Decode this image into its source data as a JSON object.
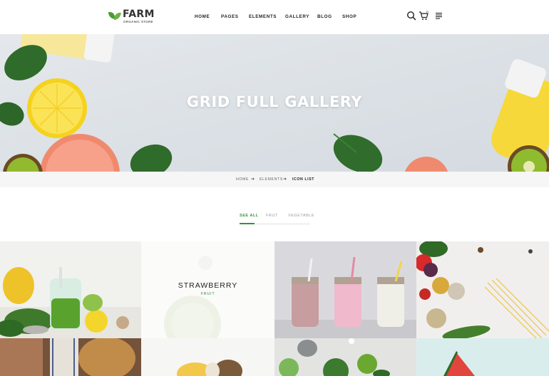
{
  "brand": {
    "name": "FARM",
    "tagline": "ORGANIC STORE",
    "accent": "#3a8f3a"
  },
  "nav": {
    "items": [
      "HOME",
      "PAGES",
      "ELEMENTS",
      "GALLERY",
      "BLOG",
      "SHOP"
    ]
  },
  "header_icons": {
    "search": "search-icon",
    "cart": "cart-icon",
    "cart_count": "0",
    "menu": "menu-icon"
  },
  "hero": {
    "title": "GRID FULL GALLERY"
  },
  "breadcrumb": {
    "items": [
      "HOME",
      "ELEMENTS",
      "ICON LIST"
    ]
  },
  "filters": {
    "items": [
      "SEE ALL",
      "FRUT",
      "VEGETABLE"
    ],
    "active": "SEE ALL"
  },
  "gallery": {
    "featured": {
      "title": "STRAWBERRY",
      "category": "FRUIT"
    },
    "tiles": [
      "smoothie-greens",
      "strawberry-hover",
      "milkshake-jars",
      "spices-pasta",
      "bread-cloth",
      "pineapple-coconut",
      "stones-fruit",
      "watermelon"
    ]
  }
}
